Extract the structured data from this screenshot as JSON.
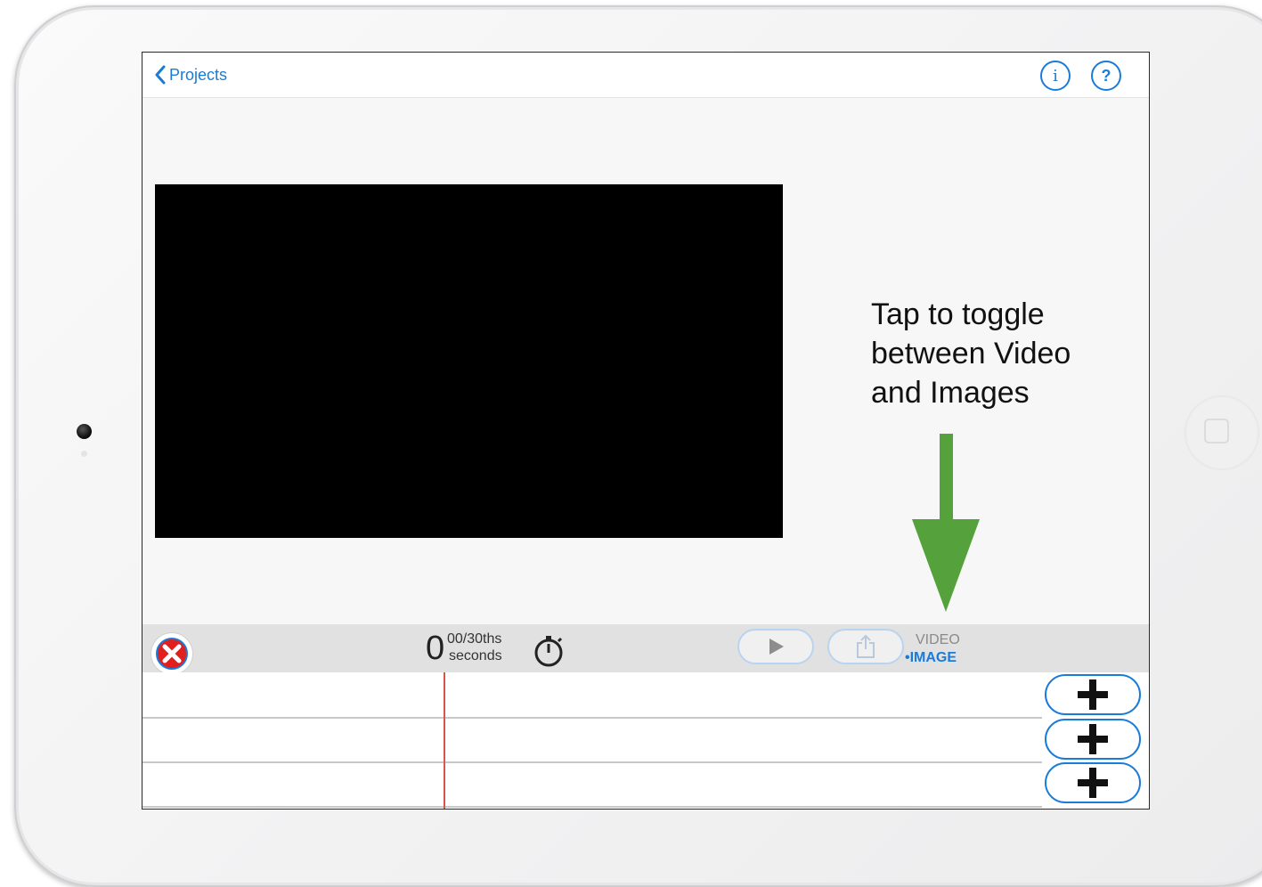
{
  "navbar": {
    "back_label": "Projects",
    "info_label": "i",
    "help_label": "?"
  },
  "annotation": {
    "text": "Tap to toggle\nbetween Video\nand Images",
    "arrow_color": "#55a23c"
  },
  "toolbar": {
    "timer_value": "0",
    "timer_fraction": "00/30ths",
    "timer_unit": "seconds",
    "mode_video": "VIDEO",
    "mode_image": "•IMAGE"
  },
  "timeline": {
    "tracks": 3,
    "add_buttons": 3
  },
  "colors": {
    "accent": "#1a7bd8",
    "delete": "#e02020",
    "playhead": "#d9534f",
    "preview": "#000000"
  },
  "icons": [
    "chevron-left-icon",
    "info-icon",
    "help-icon",
    "delete-x-icon",
    "stopwatch-icon",
    "play-icon",
    "share-icon",
    "plus-icon"
  ]
}
